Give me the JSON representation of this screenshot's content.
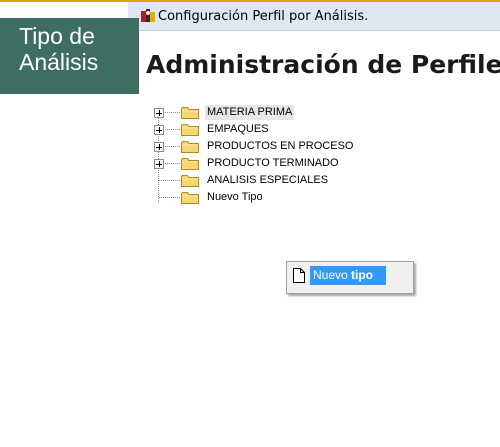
{
  "window": {
    "title": "Configuración Perfil por Análisis."
  },
  "overlay": {
    "line1": "Tipo de",
    "line2": "Análisis"
  },
  "page": {
    "title": "Administración de Perfiles"
  },
  "tree": {
    "items": [
      {
        "label": "MATERIA PRIMA",
        "expandable": true,
        "selected": true
      },
      {
        "label": "EMPAQUES",
        "expandable": true,
        "selected": false
      },
      {
        "label": "PRODUCTOS EN PROCESO",
        "expandable": true,
        "selected": false
      },
      {
        "label": "PRODUCTO TERMINADO",
        "expandable": true,
        "selected": false
      },
      {
        "label": "ANALISIS ESPECIALES",
        "expandable": false,
        "selected": false
      },
      {
        "label": "Nuevo Tipo",
        "expandable": false,
        "selected": false
      }
    ]
  },
  "context_menu": {
    "item_prefix": "Nuevo ",
    "item_bold": "tipo",
    "icon": "document-icon"
  },
  "colors": {
    "overlay_bg": "#3d6e61",
    "titlebar_bg": "#dfe7f2",
    "menu_highlight": "#3399ff",
    "folder_fill": "#f7d774"
  }
}
